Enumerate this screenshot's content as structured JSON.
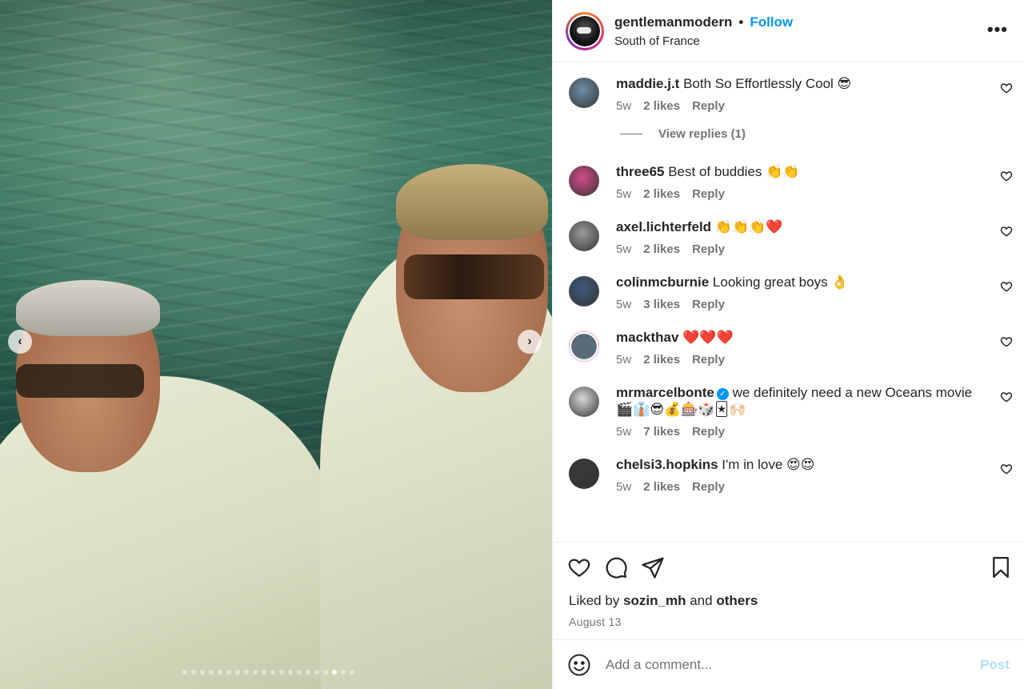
{
  "post": {
    "username": "gentlemanmodern",
    "separator": "•",
    "follow_label": "Follow",
    "location": "South of France",
    "more_icon": "more-horizontal-icon",
    "more_label": "•••"
  },
  "media": {
    "prev_arrow": "‹",
    "next_arrow": "›",
    "carousel_total": 20,
    "carousel_active": 18
  },
  "comments": [
    {
      "user": "maddie.j.t",
      "text": "Both So Effortlessly Cool 😎",
      "age": "5w",
      "likes": "2 likes",
      "reply": "Reply",
      "avatar_color": "#6f8fa6",
      "verified": false,
      "ring": false
    },
    {
      "user": "three65",
      "text": "Best of buddies 👏👏",
      "age": "5w",
      "likes": "2 likes",
      "reply": "Reply",
      "avatar_color": "#d64c8a",
      "verified": false,
      "ring": false
    },
    {
      "user": "axel.lichterfeld",
      "text": "👏👏👏❤️",
      "age": "5w",
      "likes": "2 likes",
      "reply": "Reply",
      "avatar_color": "#9a9a9a",
      "verified": false,
      "ring": false
    },
    {
      "user": "colinmcburnie",
      "text": "Looking great boys 👌",
      "age": "5w",
      "likes": "3 likes",
      "reply": "Reply",
      "avatar_color": "#3d5a7a",
      "verified": false,
      "ring": false
    },
    {
      "user": "mackthav",
      "text": "❤️❤️❤️",
      "age": "5w",
      "likes": "2 likes",
      "reply": "Reply",
      "avatar_color": "#5a6a78",
      "verified": false,
      "ring": true
    },
    {
      "user": "mrmarcelbonte",
      "text": "we definitely need a new Oceans movie 🎬👔😎💰🎰🎲🃏🙌🏻",
      "age": "5w",
      "likes": "7 likes",
      "reply": "Reply",
      "avatar_color": "#d8d8d8",
      "verified": true,
      "ring": false
    },
    {
      "user": "chelsi3.hopkins",
      "text": "I'm in love 😍😍",
      "age": "5w",
      "likes": "2 likes",
      "reply": "Reply",
      "avatar_color": "#3a3a3a",
      "verified": false,
      "ring": false
    }
  ],
  "view_replies": "View replies (1)",
  "likes_line": {
    "prefix": "Liked by",
    "user": "sozin_mh",
    "middle": "and",
    "others": "others"
  },
  "date": "August 13",
  "composer": {
    "placeholder": "Add a comment...",
    "post_label": "Post"
  },
  "colors": {
    "accent": "#0095f6",
    "post_disabled": "#b2dffc",
    "secondary_text": "#737373"
  }
}
